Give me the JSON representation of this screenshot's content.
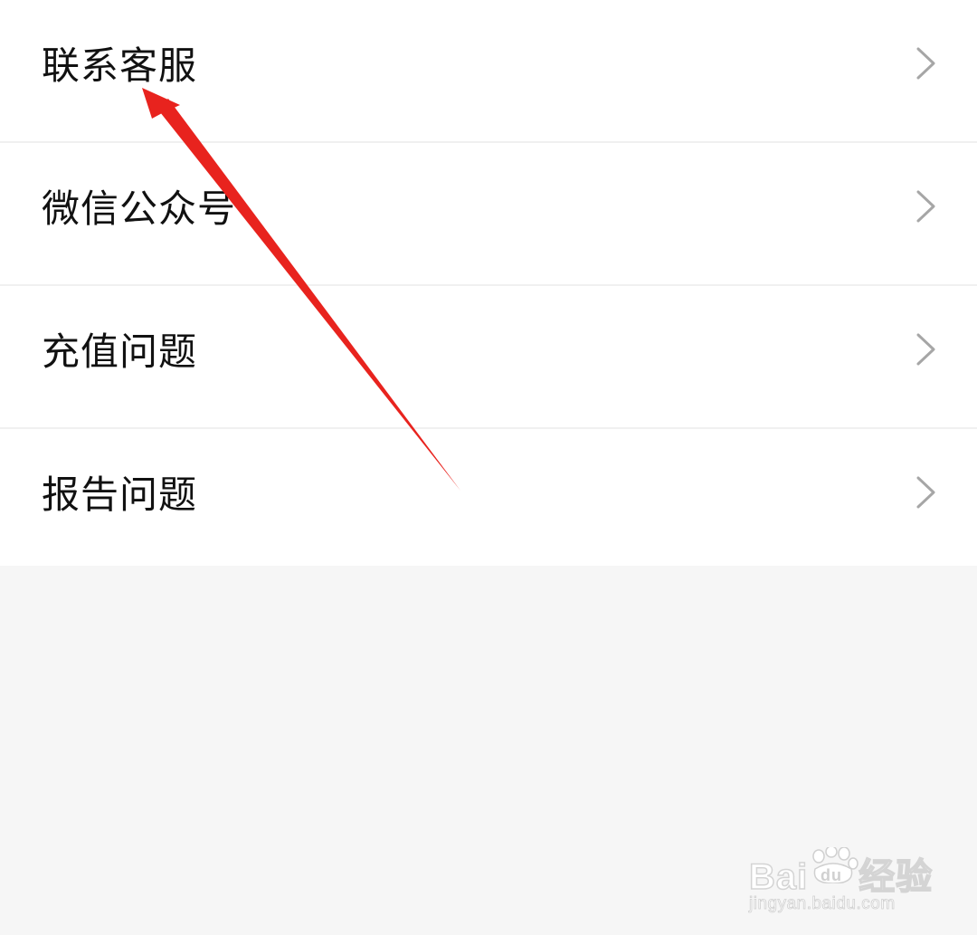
{
  "menu": {
    "items": [
      {
        "label": "联系客服",
        "icon": "chevron-right-icon"
      },
      {
        "label": "微信公众号",
        "icon": "chevron-right-icon"
      },
      {
        "label": "充值问题",
        "icon": "chevron-right-icon"
      },
      {
        "label": "报告问题",
        "icon": "chevron-right-icon"
      }
    ]
  },
  "annotation": {
    "arrow_color": "#e8231e",
    "target": "联系客服"
  },
  "watermark": {
    "brand_prefix": "Bai",
    "brand_suffix": "经验",
    "paw_text": "du",
    "url": "jingyan.baidu.com"
  },
  "colors": {
    "background": "#f6f6f6",
    "list_background": "#ffffff",
    "divider": "#f0f0f0",
    "text": "#111111",
    "chevron": "#a6a6a6"
  }
}
